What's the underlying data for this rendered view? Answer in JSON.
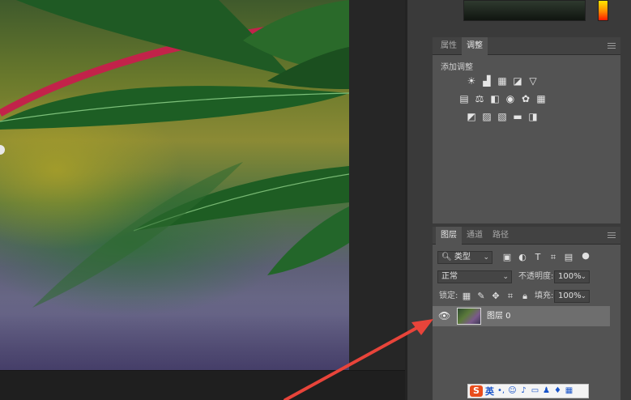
{
  "adjustments_panel": {
    "tabs": [
      {
        "label": "属性",
        "active": false
      },
      {
        "label": "调整",
        "active": true
      }
    ],
    "title": "添加调整",
    "icons": {
      "row1": [
        "brightness-contrast-icon",
        "levels-icon",
        "curves-icon",
        "exposure-icon",
        "vibrance-icon"
      ],
      "row2": [
        "hue-saturation-icon",
        "color-balance-icon",
        "black-white-icon",
        "photo-filter-icon",
        "channel-mixer-icon",
        "color-lookup-icon"
      ],
      "row3": [
        "invert-icon",
        "posterize-icon",
        "threshold-icon",
        "selective-color-icon",
        "gradient-map-icon"
      ]
    }
  },
  "layers_panel": {
    "tabs": [
      {
        "label": "图层",
        "active": true
      },
      {
        "label": "通道",
        "active": false
      },
      {
        "label": "路径",
        "active": false
      }
    ],
    "filter_kind": "类型",
    "blend_mode": "正常",
    "opacity_label": "不透明度:",
    "opacity_value": "100%",
    "lock_label": "锁定:",
    "fill_label": "填充:",
    "fill_value": "100%",
    "layers": [
      {
        "name": "图层 0",
        "visible": true,
        "selected": true
      }
    ]
  },
  "ime_toolbar": {
    "logo": "S",
    "language": "英",
    "icons": [
      "punctuation-icon",
      "emoji-icon",
      "voice-icon",
      "keyboard-icon",
      "user-icon",
      "skin-icon",
      "toolbox-icon"
    ]
  },
  "colors": {
    "panel_bg": "#535353",
    "tab_bar": "#424242",
    "selected_layer": "#6e6e6e",
    "annotation_arrow": "#e8443a"
  }
}
